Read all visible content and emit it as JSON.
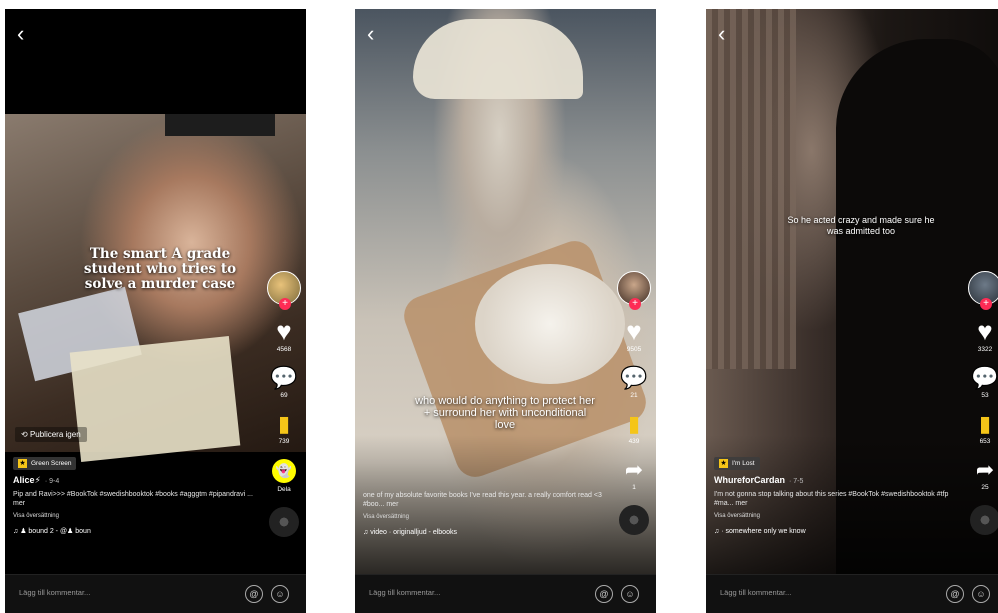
{
  "phones": [
    {
      "back_icon": "chevron-left-icon",
      "overlay_text": "The smart A grade student who tries to solve a murder case",
      "publish_label": "Publicera igen",
      "tag": "Green Screen",
      "author": "Alice",
      "author_emoji": "⚡",
      "date": "· 9-4",
      "description": "Pip and Ravi>>> #BookTok #swedishbooktok #books #agggtm #pipandravi ... mer",
      "translate": "Visa översättning",
      "music": "♫ ♟    bound 2 - @♟    boun",
      "likes": "4568",
      "comments": "69",
      "saves": "739",
      "extra_label": "Dela",
      "comment_placeholder": "Lägg till kommentar..."
    },
    {
      "back_icon": "chevron-left-icon",
      "overlay_text": "who would do anything to protect her + surround her with unconditional love",
      "tag": "",
      "author": "",
      "date": "",
      "description": "one of my absolute favorite books I've read this year. a really comfort read <3 #boo... mer",
      "translate": "Visa översättning",
      "music": "♫ video · originalljud - elbooks",
      "likes": "9505",
      "comments": "21",
      "saves": "439",
      "shares": "1",
      "comment_placeholder": "Lägg till kommentar..."
    },
    {
      "back_icon": "chevron-left-icon",
      "overlay_text": "So he acted crazy and made sure he was admitted too",
      "tag": "I'm Lost",
      "author": "WhureforCardan",
      "date": "· 7-5",
      "description": "I'm not gonna stop talking about this series #BookTok #swedishbooktok #tfp #ma... mer",
      "translate": "Visa översättning",
      "music": "♫ ·    somewhere only we know",
      "likes": "3322",
      "comments": "53",
      "saves": "653",
      "shares": "25",
      "comment_placeholder": "Lägg till kommentar..."
    }
  ],
  "colors": {
    "accent": "#fe2c55",
    "bookmark": "#f5c518",
    "snap": "#fffc00"
  }
}
